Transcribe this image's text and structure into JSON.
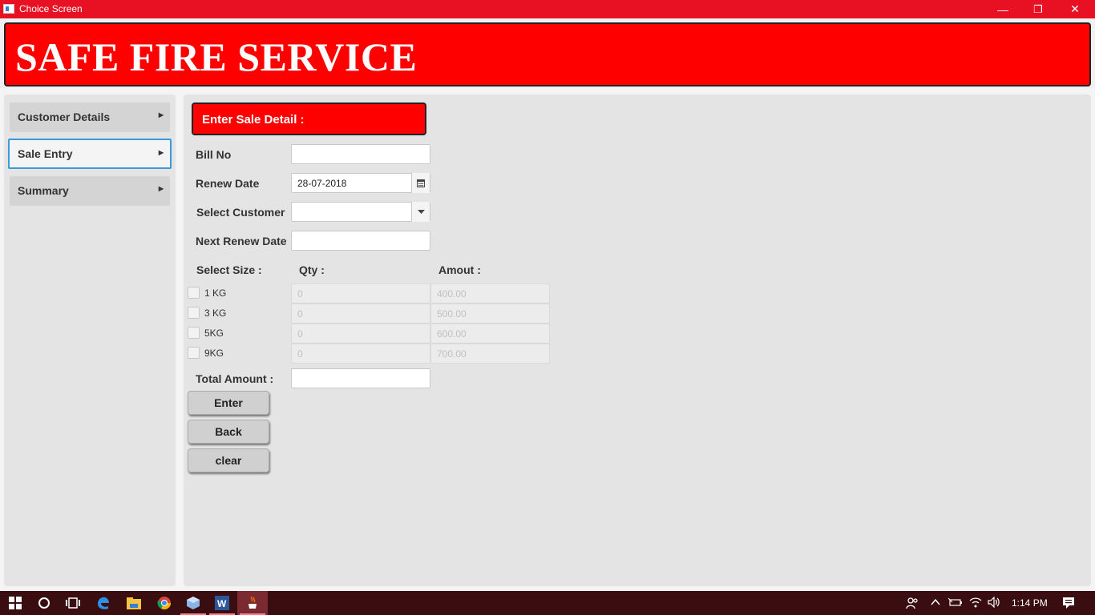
{
  "window": {
    "title": "Choice Screen",
    "minimize_glyph": "—",
    "restore_glyph": "❐",
    "close_glyph": "✕"
  },
  "banner": {
    "title": "SAFE FIRE SERVICE"
  },
  "sidebar": {
    "items": [
      {
        "label": "Customer Details",
        "arrow": "▶"
      },
      {
        "label": "Sale Entry",
        "arrow": "▶"
      },
      {
        "label": "Summary",
        "arrow": "▶"
      }
    ]
  },
  "form": {
    "section_title": "Enter Sale Detail :",
    "bill_no": {
      "label": "Bill No",
      "value": ""
    },
    "renew_date": {
      "label": "Renew Date",
      "value": "28-07-2018"
    },
    "select_customer": {
      "label": "Select Customer",
      "value": ""
    },
    "next_renew_date": {
      "label": "Next Renew Date",
      "value": ""
    },
    "size_header": "Select Size :",
    "qty_header": "Qty :",
    "amount_header": "Amout :",
    "sizes": [
      {
        "label": "1 KG",
        "qty": "0",
        "amount": "400.00"
      },
      {
        "label": "3 KG",
        "qty": "0",
        "amount": "500.00"
      },
      {
        "label": "5KG",
        "qty": "0",
        "amount": "600.00"
      },
      {
        "label": "9KG",
        "qty": "0",
        "amount": "700.00"
      }
    ],
    "total_amount": {
      "label": "Total Amount :",
      "value": ""
    },
    "buttons": {
      "enter": "Enter",
      "back": "Back",
      "clear": "clear"
    }
  },
  "taskbar": {
    "clock": "1:14 PM",
    "icons": [
      "windows-start-icon",
      "cortana-icon",
      "task-view-icon",
      "edge-icon",
      "file-explorer-icon",
      "chrome-icon",
      "package-icon",
      "word-icon",
      "java-app-icon"
    ]
  },
  "colors": {
    "titlebar": "#e81123",
    "banner": "#ff0000",
    "accent_border": "#3b9ad9"
  }
}
